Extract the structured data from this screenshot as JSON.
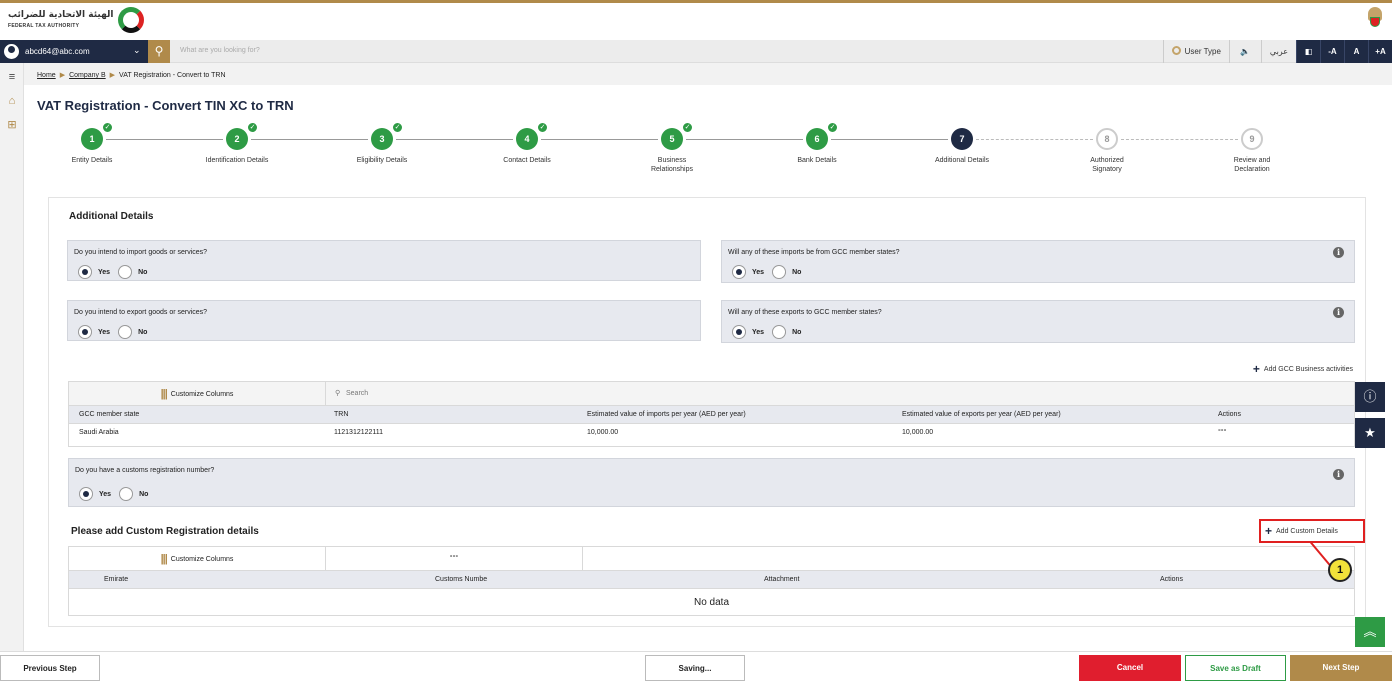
{
  "header": {
    "logo_arabic": "الهيئة الاتحادية للضرائب",
    "logo_english": "FEDERAL TAX AUTHORITY"
  },
  "toolbar": {
    "user_email": "abcd64@abc.com",
    "search_placeholder": "What are you looking for?",
    "user_type": "User Type",
    "speaker": "🔊",
    "language": "عربي",
    "font_minus": "-A",
    "font_reset": "A",
    "font_plus": "+A"
  },
  "breadcrumb": {
    "home": "Home",
    "company": "Company B",
    "current": "VAT Registration - Convert to TRN"
  },
  "page": {
    "title": "VAT Registration - Convert TIN XC to TRN"
  },
  "stepper": [
    {
      "num": "1",
      "label": "Entity Details",
      "state": "done"
    },
    {
      "num": "2",
      "label": "Identification Details",
      "state": "done"
    },
    {
      "num": "3",
      "label": "Eligibility Details",
      "state": "done"
    },
    {
      "num": "4",
      "label": "Contact Details",
      "state": "done"
    },
    {
      "num": "5",
      "label": "Business Relationships",
      "state": "done"
    },
    {
      "num": "6",
      "label": "Bank Details",
      "state": "done"
    },
    {
      "num": "7",
      "label": "Additional Details",
      "state": "current"
    },
    {
      "num": "8",
      "label": "Authorized Signatory",
      "state": "todo"
    },
    {
      "num": "9",
      "label": "Review and Declaration",
      "state": "todo"
    }
  ],
  "additional": {
    "title": "Additional Details",
    "q_import": "Do you intend to import goods or services?",
    "q_import_gcc": "Will any of these imports be from GCC member states?",
    "q_export": "Do you intend to export goods or services?",
    "q_export_gcc": "Will any of these exports to GCC member states?",
    "q_customs": "Do you have a customs registration number?",
    "yes": "Yes",
    "no": "No"
  },
  "gcc_table": {
    "add_link": "Add GCC Business activities",
    "customize": "Customize Columns",
    "search": "Search",
    "columns": [
      "GCC member state",
      "TRN",
      "Estimated value of imports per year (AED per year)",
      "Estimated value of exports per year (AED per year)",
      "Actions"
    ],
    "rows": [
      {
        "state": "Saudi Arabia",
        "trn": "1121312122111",
        "imports": "10,000.00",
        "exports": "10,000.00",
        "actions": "°°°"
      }
    ]
  },
  "custom_table": {
    "section_title": "Please add Custom Registration details",
    "add_link": "Add Custom Details",
    "customize": "Customize Columns",
    "dots": "°°°",
    "columns": [
      "Emirate",
      "Customs Numbe",
      "Attachment",
      "Actions"
    ],
    "empty": "No data"
  },
  "callout": {
    "number": "1"
  },
  "footer": {
    "previous": "Previous Step",
    "saving": "Saving...",
    "cancel": "Cancel",
    "draft": "Save as Draft",
    "next": "Next Step"
  },
  "colors": {
    "navy": "#1f2a44",
    "gold": "#b08a4a",
    "green": "#2e9b45",
    "red": "#e01e2e"
  }
}
